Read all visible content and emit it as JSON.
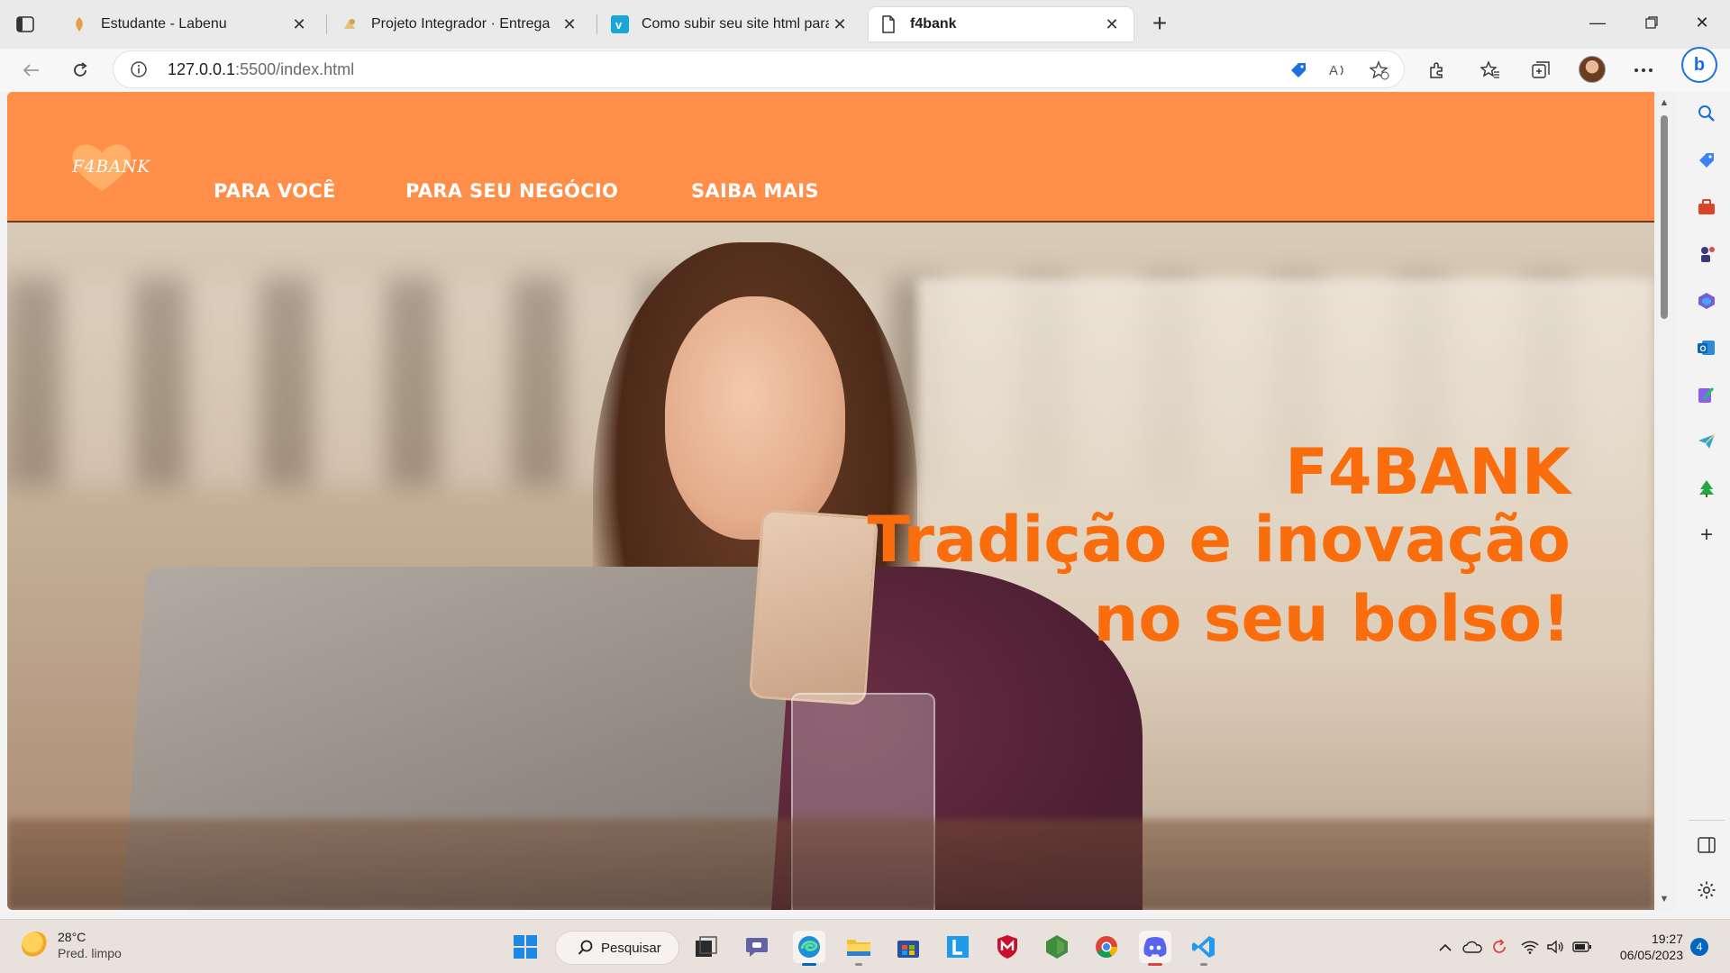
{
  "browser": {
    "tabs": [
      {
        "title": "Estudante - Labenu",
        "active": false
      },
      {
        "title": "Projeto Integrador · Entrega",
        "active": false
      },
      {
        "title": "Como subir seu site html para a",
        "active": false
      },
      {
        "title": "f4bank",
        "active": true
      }
    ],
    "address": {
      "host": "127.0.0.1",
      "rest": ":5500/index.html"
    }
  },
  "page": {
    "logo_text": "F4BANK",
    "nav": [
      "PARA VOCÊ",
      "PARA SEU NEGÓCIO",
      "SAIBA MAIS"
    ],
    "hero": {
      "line1": "F4BANK",
      "line2": "Tradição e inovação",
      "line3": "no seu bolso!"
    },
    "colors": {
      "header": "#ff8e48",
      "headline": "#f96d0c"
    }
  },
  "taskbar": {
    "weather": {
      "temp": "28°C",
      "desc": "Pred. limpo"
    },
    "search_label": "Pesquisar",
    "time": "19:27",
    "date": "06/05/2023",
    "notifications": "4"
  }
}
